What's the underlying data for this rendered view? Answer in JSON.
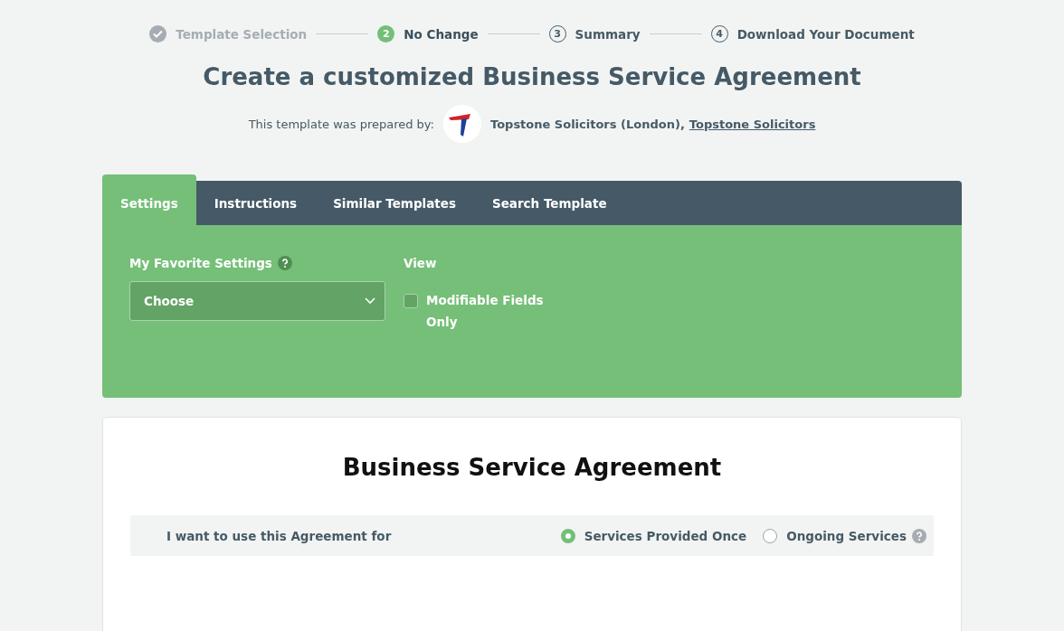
{
  "steps": [
    {
      "label": "Template Selection",
      "completed": true,
      "selected": false
    },
    {
      "number": "2",
      "label": "No Change",
      "completed": false,
      "selected": true
    },
    {
      "number": "3",
      "label": "Summary",
      "completed": false,
      "selected": false
    },
    {
      "number": "4",
      "label": "Download Your Document",
      "completed": false,
      "selected": false
    }
  ],
  "title": "Create a customized Business Service Agreement",
  "prepared_by": {
    "label": "This template was prepared by:",
    "author": "Topstone Solicitors (London),",
    "link": "Topstone Solicitors"
  },
  "tabs": [
    {
      "label": "Settings",
      "selected": true
    },
    {
      "label": "Instructions",
      "selected": false
    },
    {
      "label": "Similar Templates",
      "selected": false
    },
    {
      "label": "Search Template",
      "selected": false
    }
  ],
  "settings": {
    "favorites_label": "My Favorite Settings",
    "favorites_value": "Choose",
    "view_label": "View",
    "modifiable_only": {
      "label": "Modifiable Fields Only",
      "checked": false
    }
  },
  "document": {
    "heading": "Business Service Agreement",
    "question": {
      "label": "I want to use this Agreement for",
      "options": [
        {
          "label": "Services Provided Once",
          "selected": true
        },
        {
          "label": "Ongoing Services",
          "selected": false
        }
      ]
    }
  }
}
